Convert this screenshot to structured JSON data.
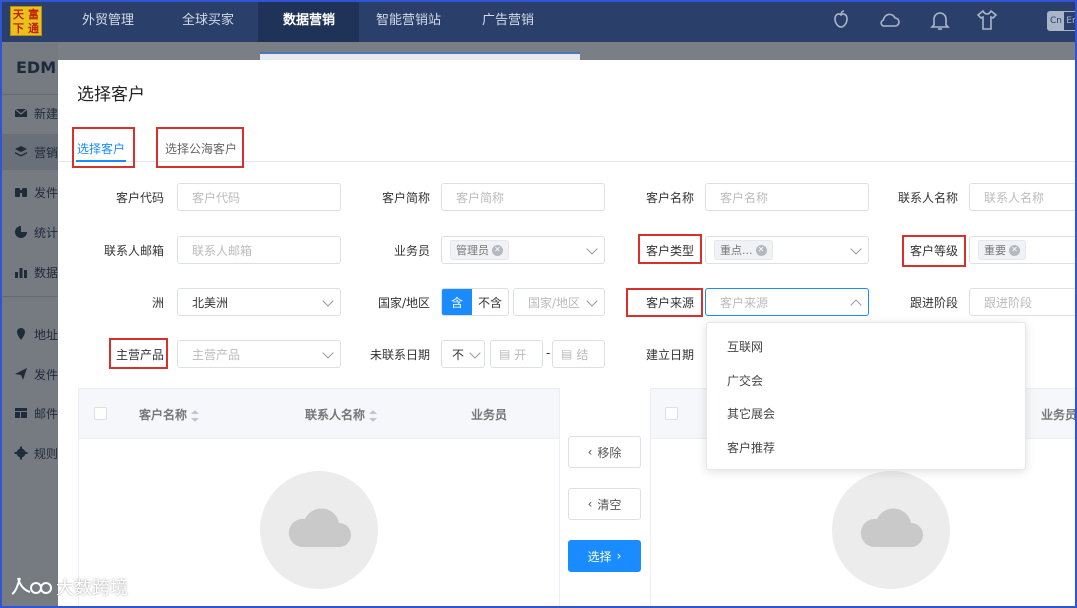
{
  "nav": {
    "logo_chars": [
      "天",
      "富",
      "下",
      "通"
    ],
    "items": [
      {
        "label": "外贸管理"
      },
      {
        "label": "全球买家"
      },
      {
        "label": "数据营销",
        "active": true
      },
      {
        "label": "智能营销站"
      },
      {
        "label": "广告营销"
      }
    ],
    "icons": [
      "apple-icon",
      "cloud-icon",
      "bell-icon",
      "tshirt-icon"
    ],
    "lang": {
      "cn": "Cn",
      "en": "En"
    }
  },
  "sidebar": {
    "title": "EDM",
    "items": [
      {
        "label": "新建",
        "icon": "mail-icon"
      },
      {
        "label": "营销",
        "icon": "layers-icon",
        "active": true
      },
      {
        "label": "发件",
        "icon": "binoculars-icon"
      },
      {
        "label": "统计",
        "icon": "pie-chart-icon"
      },
      {
        "label": "数据",
        "icon": "bar-chart-icon"
      },
      {
        "label": "地址",
        "icon": "location-pin-icon"
      },
      {
        "label": "发件",
        "icon": "send-icon"
      },
      {
        "label": "邮件",
        "icon": "template-icon"
      },
      {
        "label": "规则",
        "icon": "gear-icon"
      }
    ]
  },
  "modal": {
    "title": "选择客户",
    "tabs": [
      {
        "label": "选择客户",
        "active": true
      },
      {
        "label": "选择公海客户"
      }
    ],
    "form": {
      "customer_code": {
        "label": "客户代码",
        "placeholder": "客户代码"
      },
      "customer_short": {
        "label": "客户简称",
        "placeholder": "客户简称"
      },
      "customer_name": {
        "label": "客户名称",
        "placeholder": "客户名称"
      },
      "contact_name": {
        "label": "联系人名称",
        "placeholder": "联系人名称"
      },
      "contact_email": {
        "label": "联系人邮箱",
        "placeholder": "联系人邮箱"
      },
      "salesperson": {
        "label": "业务员",
        "tag": "管理员"
      },
      "customer_type": {
        "label": "客户类型",
        "tag": "重点..."
      },
      "customer_level": {
        "label": "客户等级",
        "tag": "重要"
      },
      "continent": {
        "label": "洲",
        "value": "北美洲"
      },
      "country": {
        "label": "国家/地区",
        "include": "含",
        "exclude": "不含",
        "placeholder": "国家/地区"
      },
      "customer_source": {
        "label": "客户来源",
        "placeholder": "客户来源"
      },
      "follow_stage": {
        "label": "跟进阶段",
        "placeholder": "跟进阶段"
      },
      "main_product": {
        "label": "主营产品",
        "placeholder": "主营产品"
      },
      "last_contact": {
        "label": "未联系日期",
        "op": "不",
        "from_placeholder": "开",
        "to_placeholder": "结",
        "separator": "-"
      },
      "created_date": {
        "label": "建立日期"
      }
    },
    "source_options": [
      "互联网",
      "广交会",
      "其它展会",
      "客户推荐"
    ],
    "left_table": {
      "columns": [
        "客户名称",
        "联系人名称",
        "业务员"
      ]
    },
    "right_table": {
      "columns": [
        "业务员"
      ]
    },
    "buttons": {
      "remove": "移除",
      "clear": "清空",
      "select": "选择"
    }
  },
  "watermark": {
    "text": "大数跨境"
  }
}
